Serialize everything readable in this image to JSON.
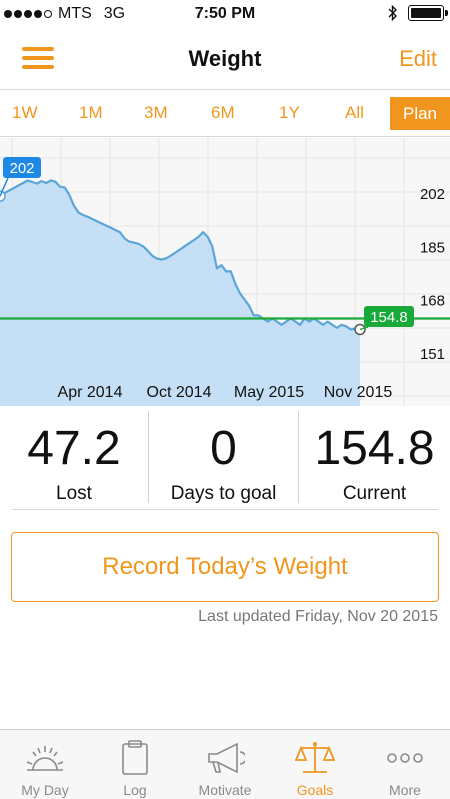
{
  "status_bar": {
    "carrier": "MTS",
    "network": "3G",
    "time": "7:50 PM"
  },
  "nav": {
    "title": "Weight",
    "edit_label": "Edit"
  },
  "range_tabs": [
    "1W",
    "1M",
    "3M",
    "6M",
    "1Y",
    "All"
  ],
  "plan_tab": "Plan",
  "chart_data": {
    "type": "area",
    "x_tick_labels": [
      "Apr 2014",
      "Oct 2014",
      "May 2015",
      "Nov 2015"
    ],
    "y_tick_labels": [
      "202",
      "185",
      "168",
      "151"
    ],
    "y_ticks": [
      202,
      185,
      168,
      151
    ],
    "start_label": "202",
    "goal_label": "154.8",
    "goal_value": 162,
    "series_color": "#5aa6d8",
    "fill_color": "#bcdcf6",
    "goal_color": "#19a83a",
    "values": [
      201,
      202,
      202.8,
      203.6,
      204.4,
      205.2,
      206,
      205.5,
      205,
      205.8,
      205.2,
      206,
      205.6,
      204,
      203.8,
      201.5,
      198,
      195.8,
      195,
      194.4,
      193.7,
      193,
      192.3,
      191.6,
      190.9,
      190.2,
      189.5,
      187.5,
      186.5,
      186.2,
      185.8,
      185,
      183.6,
      182,
      181.1,
      180.8,
      181.2,
      182,
      183,
      184,
      185,
      186,
      187,
      188,
      189.5,
      188,
      185,
      178,
      179,
      177,
      177,
      173,
      170,
      168,
      166,
      163,
      163,
      162,
      161,
      162,
      161,
      160,
      161,
      162,
      161,
      160,
      162,
      161,
      162,
      161,
      160,
      161,
      160,
      159,
      160,
      159.5,
      158.5,
      158.8,
      158.5
    ]
  },
  "stats": [
    {
      "value": "47.2",
      "label": "Lost"
    },
    {
      "value": "0",
      "label": "Days to goal"
    },
    {
      "value": "154.8",
      "label": "Current"
    }
  ],
  "record_button": "Record Today’s Weight",
  "last_updated": "Last updated Friday, Nov 20 2015",
  "tab_bar": [
    {
      "label": "My Day",
      "icon": "sunrise-icon",
      "active": false
    },
    {
      "label": "Log",
      "icon": "clipboard-icon",
      "active": false
    },
    {
      "label": "Motivate",
      "icon": "megaphone-icon",
      "active": false
    },
    {
      "label": "Goals",
      "icon": "scale-icon",
      "active": true
    },
    {
      "label": "More",
      "icon": "more-icon",
      "active": false
    }
  ]
}
